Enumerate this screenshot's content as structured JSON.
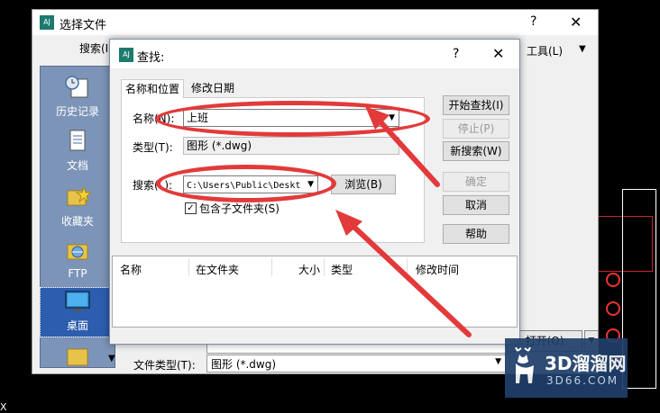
{
  "outer_dialog": {
    "title": "选择文件",
    "help_symbol": "?",
    "close_symbol": "✕",
    "search_label": "搜索(I",
    "tools_label": "工具(L)",
    "dropdown_symbol": "▼",
    "places": [
      {
        "label": "历史记录",
        "icon": "history-icon"
      },
      {
        "label": "文档",
        "icon": "documents-icon"
      },
      {
        "label": "收藏夹",
        "icon": "favorites-icon"
      },
      {
        "label": "FTP",
        "icon": "ftp-icon"
      },
      {
        "label": "桌面",
        "icon": "desktop-icon"
      }
    ],
    "file_type_label": "文件类型(T):",
    "file_type_value": "图形 (*.dwg)",
    "open_label": "打开(O)",
    "scroll_down": "▼"
  },
  "find_dialog": {
    "title": "查找:",
    "help_symbol": "?",
    "close_symbol": "✕",
    "tabs": [
      "名称和位置",
      "修改日期"
    ],
    "name_label": "名称(N):",
    "name_value": "上班",
    "type_label": "类型(T):",
    "type_value": "图形 (*.dwg)",
    "search_in_label": "搜索(L):",
    "search_in_value": "C:\\Users\\Public\\Deskt",
    "browse_label": "浏览(B)",
    "include_sub_label": "包含子文件夹(S)",
    "include_sub_checked": true,
    "check_mark": "✓",
    "buttons": {
      "start": "开始查找(I)",
      "stop": "停止(P)",
      "new_search": "新搜索(W)",
      "ok": "确定",
      "cancel": "取消",
      "help": "帮助"
    },
    "columns": [
      "名称",
      "在文件夹",
      "大小",
      "类型",
      "修改时间"
    ]
  },
  "watermark": {
    "brand": "3D溜溜网",
    "site": "3D66.COM"
  },
  "colors": {
    "annotation_red": "#e23a3a",
    "places_bg": "#7c94b7",
    "watermark_bg": "#1f3f6b"
  },
  "cad_cursor_text": "X"
}
